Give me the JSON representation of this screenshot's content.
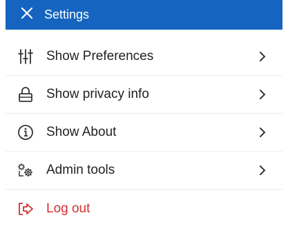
{
  "header": {
    "title": "Settings",
    "close_icon": "close-icon",
    "background_color": "#1565c0"
  },
  "menu": {
    "items": [
      {
        "label": "Show Preferences",
        "icon": "sliders-icon"
      },
      {
        "label": "Show privacy info",
        "icon": "lock-icon"
      },
      {
        "label": "Show About",
        "icon": "info-icon"
      },
      {
        "label": "Admin tools",
        "icon": "admin-gears-icon"
      }
    ],
    "logout": {
      "label": "Log out",
      "icon": "logout-icon",
      "color": "#d32f2f"
    }
  }
}
